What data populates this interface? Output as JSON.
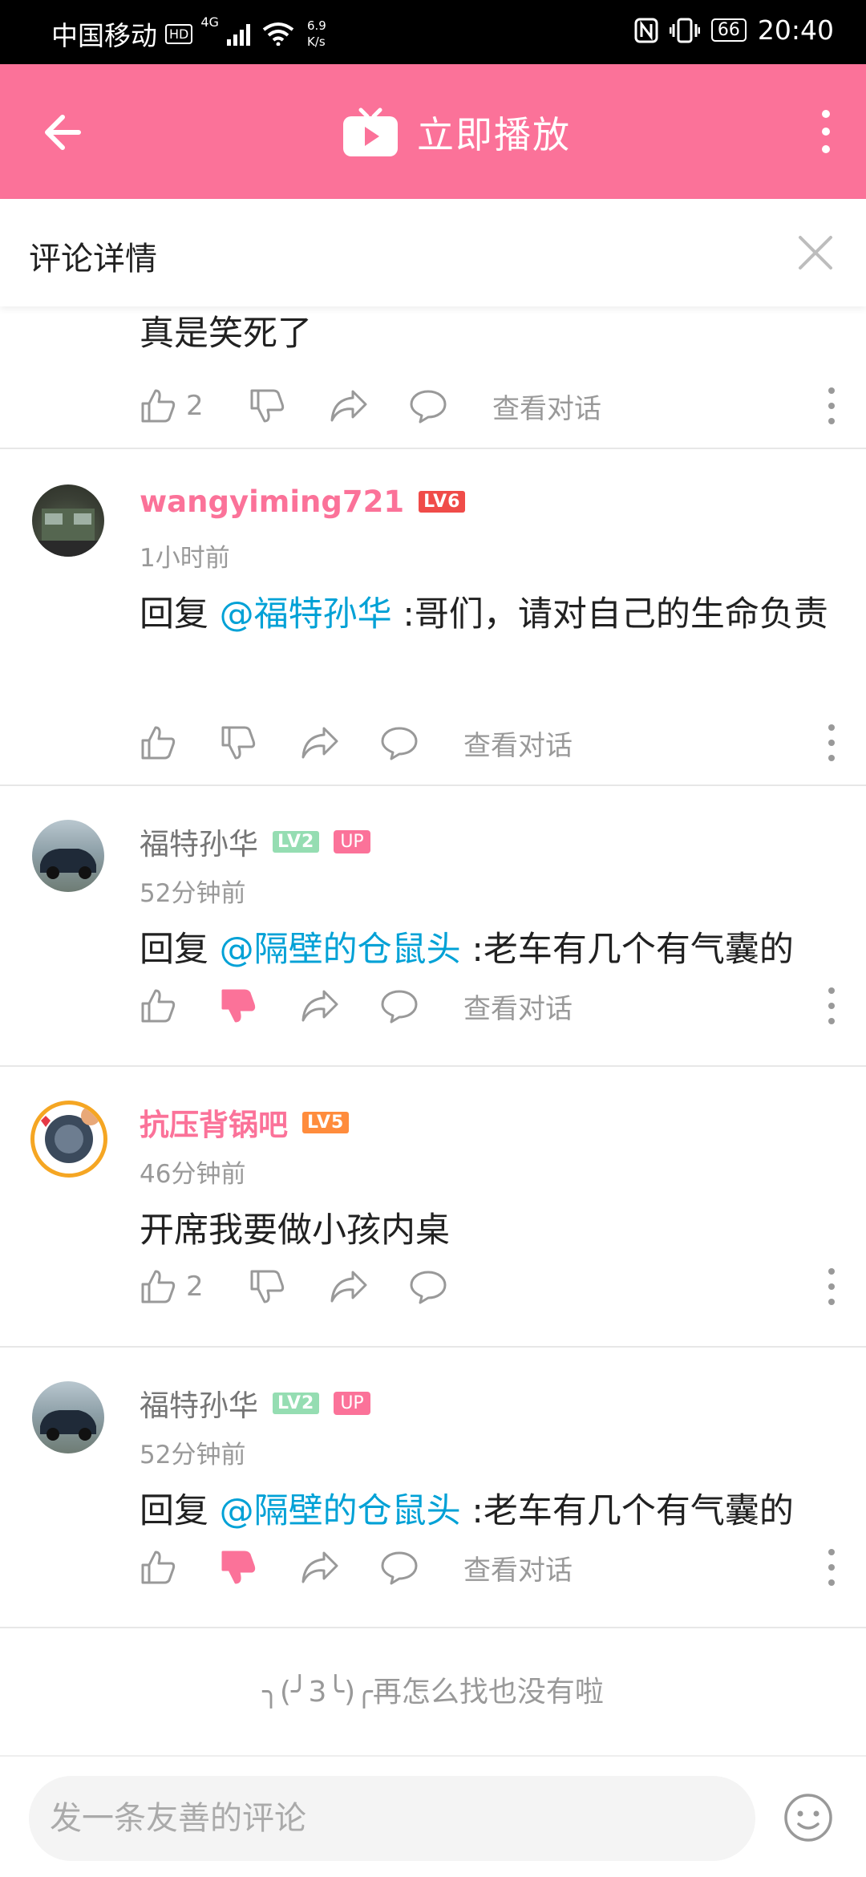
{
  "status_bar": {
    "carrier": "中国移动",
    "hd": "HD",
    "signal": "4G",
    "net_speed_value": "6.9",
    "net_speed_unit": "K/s",
    "battery": "66",
    "time": "20:40"
  },
  "app_bar": {
    "title": "立即播放",
    "accent": "#fb7299"
  },
  "detail": {
    "title": "评论详情"
  },
  "partial_comment": {
    "text": "真是笑死了",
    "likes": "2",
    "view_conversation": "查看对话"
  },
  "comments": [
    {
      "username": "wangyiming721",
      "level": "LV6",
      "time": "1小时前",
      "reply_prefix": "回复 ",
      "mention": "@福特孙华",
      "text": " :哥们，请对自己的生命负责",
      "likes": "",
      "view_conversation": "查看对话"
    },
    {
      "username": "福特孙华",
      "level": "LV2",
      "badge": "UP",
      "time": "52分钟前",
      "reply_prefix": "回复 ",
      "mention": "@隔壁的仓鼠头",
      "text": " :老车有几个有气囊的",
      "likes": "",
      "view_conversation": "查看对话"
    },
    {
      "username": "抗压背锅吧",
      "level": "LV5",
      "time": "46分钟前",
      "text": "开席我要做小孩内桌",
      "likes": "2"
    },
    {
      "username": "福特孙华",
      "level": "LV2",
      "badge": "UP",
      "time": "52分钟前",
      "reply_prefix": "回复 ",
      "mention": "@隔壁的仓鼠头",
      "text": " :老车有几个有气囊的",
      "likes": "",
      "view_conversation": "查看对话"
    }
  ],
  "end_message": "╮(╯3╰)╭再怎么找也没有啦",
  "input": {
    "placeholder": "发一条友善的评论"
  }
}
